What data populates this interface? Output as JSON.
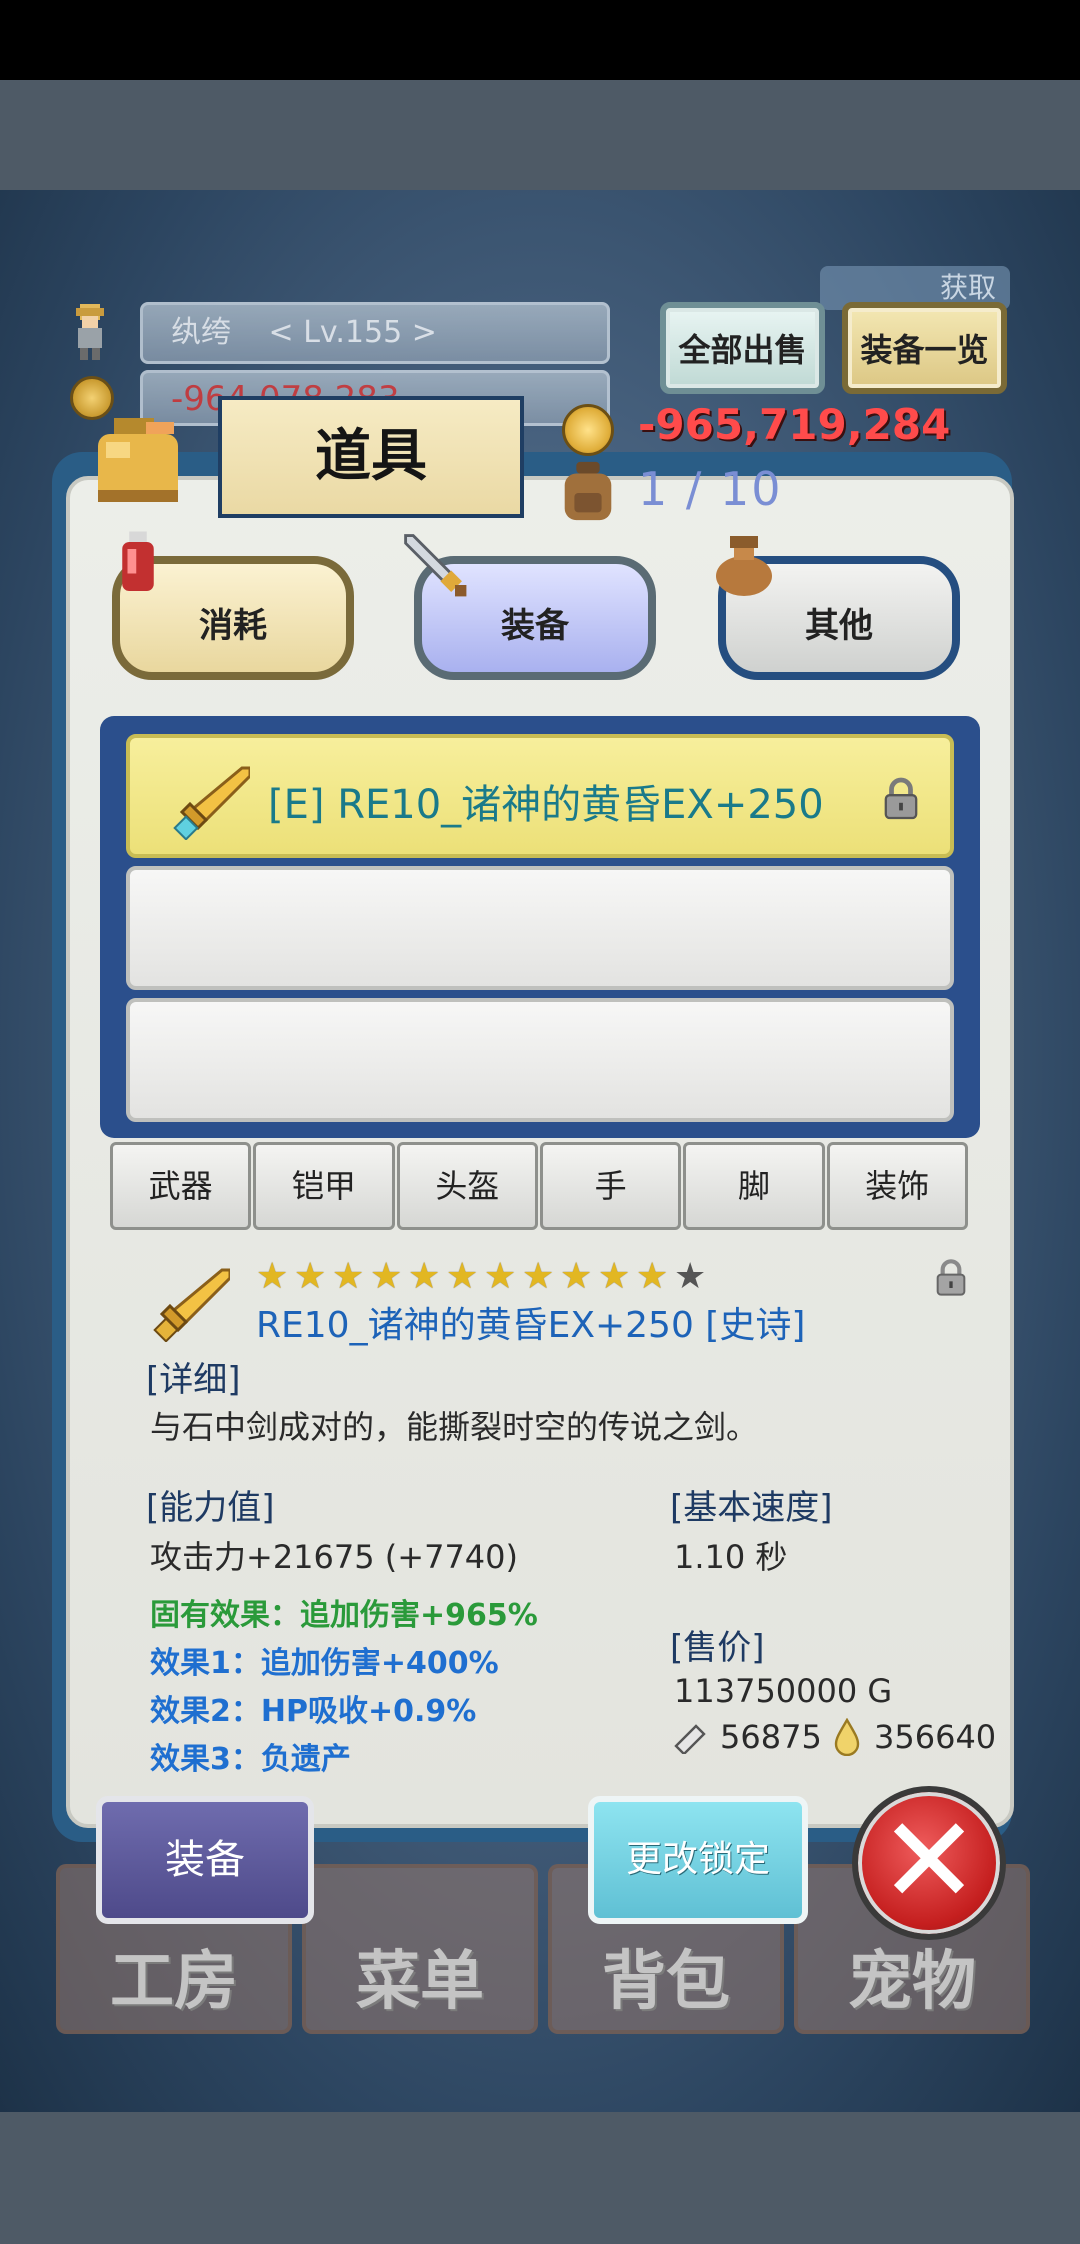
{
  "header": {
    "player_name": "纨绔",
    "level": "< Lv.155 >",
    "gold_faded": "-964,078,283",
    "sell_all": "全部出售",
    "equip_list": "装备一览",
    "obtain": "获取",
    "gold": "-965,719,284",
    "capacity": "1 / 10"
  },
  "panel": {
    "title": "道具",
    "tabs": [
      "消耗",
      "装备",
      "其他"
    ],
    "active_tab": "装备"
  },
  "items": {
    "slot1_name": "[E] RE10_诸神的黄昏EX+250",
    "slot2_name": "",
    "slot3_name": ""
  },
  "categories": [
    "武器",
    "铠甲",
    "头盔",
    "手",
    "脚",
    "装饰"
  ],
  "detail": {
    "stars_filled": 11,
    "stars_total": 12,
    "title": "RE10_诸神的黄昏EX+250 [史诗]",
    "detail_header": "[详细]",
    "description": "与石中剑成对的，能撕裂时空的传说之剑。",
    "ability_header": "[能力值]",
    "attack": "攻击力+21675 (+7740)",
    "inherent_effect": "固有效果：追加伤害+965%",
    "effect1": "效果1：追加伤害+400%",
    "effect2": "效果2：HP吸收+0.9%",
    "effect3": "效果3：负遗产",
    "speed_header": "[基本速度]",
    "speed": "1.10 秒",
    "price_header": "[售价]",
    "price_gold": "113750000 G",
    "price_ore": "56875",
    "price_drop": "356640"
  },
  "bottom_nav": [
    "工房",
    "菜单",
    "背包",
    "宠物"
  ],
  "actions": {
    "equip": "装备",
    "change_lock": "更改锁定"
  },
  "colors": {
    "gold_text": "#ff4b4b",
    "item_name": "#1a7a8a",
    "title_blue": "#1d63b8",
    "inherent_green": "#2a9a3a",
    "effect_blue": "#1f6fd0"
  }
}
